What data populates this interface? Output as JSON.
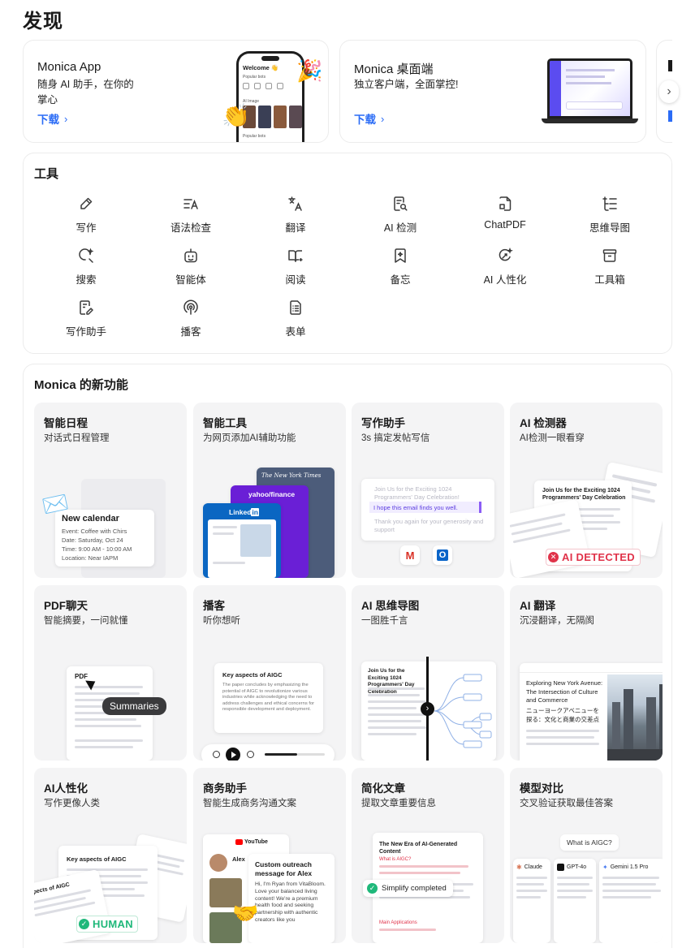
{
  "page": {
    "title": "发现"
  },
  "promos": [
    {
      "title": "Monica App",
      "desc": "随身 AI 助手，在你的掌心",
      "link": "下载"
    },
    {
      "title": "Monica 桌面端",
      "desc": "独立客户端，全面掌控!",
      "link": "下载"
    }
  ],
  "phone_mock": {
    "welcome": "Welcome 👋",
    "popular": "Popular bots",
    "image": "AI Image",
    "popular2": "Popular bots"
  },
  "tools": {
    "title": "工具",
    "items": [
      {
        "label": "写作",
        "icon": "pen-icon"
      },
      {
        "label": "语法检查",
        "icon": "grammar-icon"
      },
      {
        "label": "翻译",
        "icon": "translate-icon"
      },
      {
        "label": "AI 检测",
        "icon": "ai-detect-icon"
      },
      {
        "label": "ChatPDF",
        "icon": "pdf-icon"
      },
      {
        "label": "思维导图",
        "icon": "mindmap-icon"
      },
      {
        "label": "搜索",
        "icon": "search-icon"
      },
      {
        "label": "智能体",
        "icon": "bot-icon"
      },
      {
        "label": "阅读",
        "icon": "book-icon"
      },
      {
        "label": "备忘",
        "icon": "bookmark-icon"
      },
      {
        "label": "AI 人性化",
        "icon": "humanize-icon"
      },
      {
        "label": "工具箱",
        "icon": "toolbox-icon"
      },
      {
        "label": "写作助手",
        "icon": "write-assist-icon"
      },
      {
        "label": "播客",
        "icon": "podcast-icon"
      },
      {
        "label": "表单",
        "icon": "form-icon"
      }
    ]
  },
  "features": {
    "title": "Monica 的新功能",
    "items": [
      {
        "title": "智能日程",
        "sub": "对话式日程管理"
      },
      {
        "title": "智能工具",
        "sub": "为网页添加AI辅助功能"
      },
      {
        "title": "写作助手",
        "sub": "3s 搞定发帖写信"
      },
      {
        "title": "AI 检测器",
        "sub": "AI检测一眼看穿"
      },
      {
        "title": "PDF聊天",
        "sub": "智能摘要，一问就懂"
      },
      {
        "title": "播客",
        "sub": "听你想听"
      },
      {
        "title": "AI 思维导图",
        "sub": "一图胜千言"
      },
      {
        "title": "AI 翻译",
        "sub": "沉浸翻译，无隔阂"
      },
      {
        "title": "AI人性化",
        "sub": "写作更像人类"
      },
      {
        "title": "商务助手",
        "sub": "智能生成商务沟通文案"
      },
      {
        "title": "简化文章",
        "sub": "提取文章重要信息"
      },
      {
        "title": "模型对比",
        "sub": "交叉验证获取最佳答案"
      }
    ]
  },
  "previews": {
    "calendar": {
      "title": "New calendar",
      "l1": "Event: Coffee with Chirs",
      "l2": "Date: Saturday, Oct 24",
      "l3": "Time: 9:00 AM - 10:00 AM",
      "l4": "Location: Near IAPM"
    },
    "tools": {
      "nyt": "The New York Times",
      "yahoo": "yahoo/finance",
      "linkedin": "Linked",
      "linkedin_in": "in"
    },
    "writing": {
      "l1": "Join Us for the Exciting 1024 Programmers' Day Celebration!",
      "l2": "I hope this email finds you well.",
      "l3": "Thank you again for your generosity and support"
    },
    "detector": {
      "badge": "AI DETECTED",
      "title": "Join Us for the Exciting 1024 Programmers' Day Celebration"
    },
    "pdf": {
      "label": "PDF",
      "bubble": "Summaries"
    },
    "podcast": {
      "title": "Key aspects of AIGC",
      "body": "The paper concludes by emphasizing the potential of AIGC to revolutionize various industries while acknowledging the need to address challenges and ethical concerns for responsible development and deployment."
    },
    "mindmap": {
      "title": "Join Us for the Exciting 1024 Programmers' Day Celebration"
    },
    "translate": {
      "en": "Exploring New York Avenue: The Intersection of Culture and Commerce",
      "jp": "ニューヨークアベニューを探る：文化と商業の交差点"
    },
    "humanize": {
      "title": "Key aspects of AIGC",
      "badge": "HUMAN",
      "side": "spects of AIGC"
    },
    "business": {
      "brand": "YouTube",
      "name": "Alex",
      "msg_title": "Custom outreach message for Alex",
      "msg_body": "Hi, I'm Ryan from VitaBloom. Love your balanced living content! We're a premium health food and seeking partnership with authentic creators like you"
    },
    "simplify": {
      "title": "The New Era of AI-Generated Content",
      "section": "What is AIGC?",
      "badge": "Simplify completed",
      "foot": "Main Applications"
    },
    "compare": {
      "question": "What is AIGC?",
      "m1": "Claude",
      "m2": "GPT-4o",
      "m3": "Gemini 1.5 Pro"
    }
  },
  "colors": {
    "accent": "#2b6cf6",
    "icon": "#3a3a3a",
    "card_bg": "#f4f4f5",
    "ai_badge": "#e0334a",
    "human_badge": "#1fb87a"
  }
}
